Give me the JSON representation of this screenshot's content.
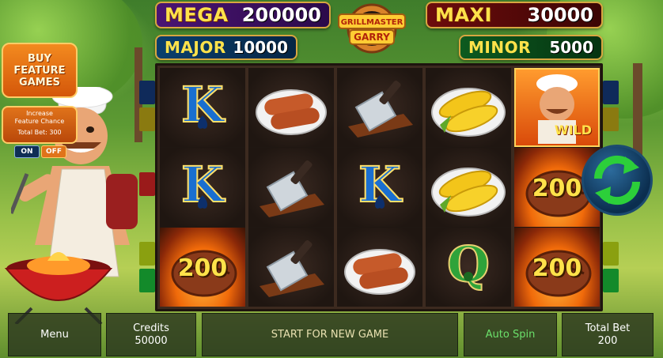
{
  "jackpots": {
    "mega": {
      "name": "MEGA",
      "value": "200000"
    },
    "maxi": {
      "name": "MAXI",
      "value": "30000"
    },
    "major": {
      "name": "MAJOR",
      "value": "10000"
    },
    "minor": {
      "name": "MINOR",
      "value": "5000"
    }
  },
  "logo": {
    "line1": "GRILLMASTER",
    "line2": "GARRY"
  },
  "left_panel": {
    "buy_feature": "BUY FEATURE GAMES",
    "increase_line1": "Increase",
    "increase_line2": "Feature Chance",
    "total_bet_text": "Total Bet:   300",
    "on_label": "ON",
    "off_label": "OFF"
  },
  "reels": [
    [
      {
        "symbol": "K",
        "bg": "dark"
      },
      {
        "symbol": "K",
        "bg": "dark"
      },
      {
        "symbol": "steak",
        "value": "200",
        "bg": "fire"
      }
    ],
    [
      {
        "symbol": "sausages",
        "bg": "dark"
      },
      {
        "symbol": "cleaver",
        "bg": "dark"
      },
      {
        "symbol": "cleaver",
        "bg": "dark"
      }
    ],
    [
      {
        "symbol": "cleaver",
        "bg": "dark"
      },
      {
        "symbol": "K",
        "bg": "dark"
      },
      {
        "symbol": "sausages",
        "bg": "dark"
      }
    ],
    [
      {
        "symbol": "corn",
        "bg": "dark"
      },
      {
        "symbol": "corn",
        "bg": "dark"
      },
      {
        "symbol": "Q",
        "bg": "dark"
      }
    ],
    [
      {
        "symbol": "wild",
        "label": "WILD",
        "bg": "wild"
      },
      {
        "symbol": "steak",
        "value": "200",
        "bg": "fire"
      },
      {
        "symbol": "steak",
        "value": "200",
        "bg": "fire"
      }
    ]
  ],
  "bottom_bar": {
    "menu": "Menu",
    "credits_label": "Credits",
    "credits_value": "50000",
    "start_message": "START FOR NEW GAME",
    "auto_spin": "Auto Spin",
    "total_bet_label": "Total Bet",
    "total_bet_value": "200"
  },
  "icons": {
    "spin": "refresh-arrows-icon",
    "grill": "grill-icon",
    "chef": "chef-character-icon"
  },
  "colors": {
    "accent_gold": "#ffe24a",
    "spin_green": "#2ccf3a",
    "panel_orange": "#e0731a"
  }
}
